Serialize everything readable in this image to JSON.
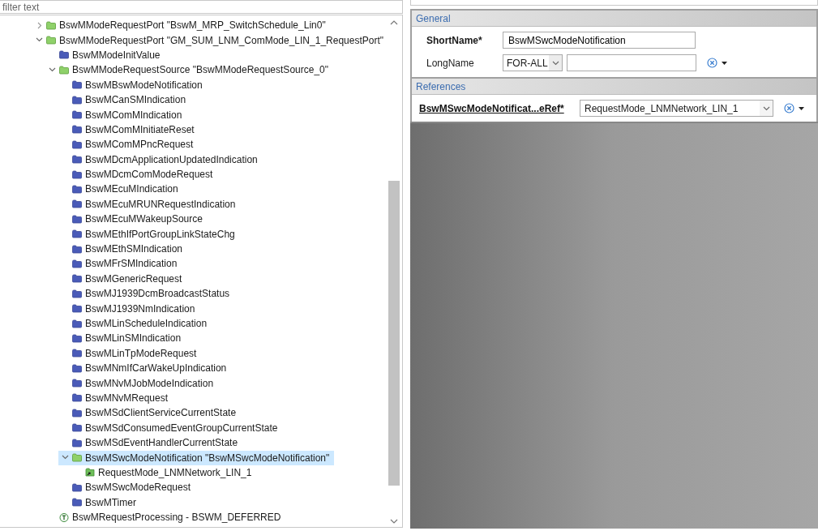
{
  "filter": {
    "placeholder": "filter text"
  },
  "tree": [
    {
      "kind": "container",
      "label": "BswMModeRequestPort \"BswM_MRP_SwitchSchedule_Lin0\"",
      "expanded": false,
      "selected": false
    },
    {
      "kind": "container",
      "label": "BswMModeRequestPort \"GM_SUM_LNM_ComMode_LIN_1_RequestPort\"",
      "expanded": true,
      "selected": false,
      "children": [
        {
          "kind": "folder",
          "label": "BswMModeInitValue",
          "selected": false
        },
        {
          "kind": "container",
          "label": "BswMModeRequestSource \"BswMModeRequestSource_0\"",
          "expanded": true,
          "selected": false,
          "children": [
            {
              "kind": "folder",
              "label": "BswMBswModeNotification",
              "selected": false
            },
            {
              "kind": "folder",
              "label": "BswMCanSMIndication",
              "selected": false
            },
            {
              "kind": "folder",
              "label": "BswMComMIndication",
              "selected": false
            },
            {
              "kind": "folder",
              "label": "BswMComMInitiateReset",
              "selected": false
            },
            {
              "kind": "folder",
              "label": "BswMComMPncRequest",
              "selected": false
            },
            {
              "kind": "folder",
              "label": "BswMDcmApplicationUpdatedIndication",
              "selected": false
            },
            {
              "kind": "folder",
              "label": "BswMDcmComModeRequest",
              "selected": false
            },
            {
              "kind": "folder",
              "label": "BswMEcuMIndication",
              "selected": false
            },
            {
              "kind": "folder",
              "label": "BswMEcuMRUNRequestIndication",
              "selected": false
            },
            {
              "kind": "folder",
              "label": "BswMEcuMWakeupSource",
              "selected": false
            },
            {
              "kind": "folder",
              "label": "BswMEthIfPortGroupLinkStateChg",
              "selected": false
            },
            {
              "kind": "folder",
              "label": "BswMEthSMIndication",
              "selected": false
            },
            {
              "kind": "folder",
              "label": "BswMFrSMIndication",
              "selected": false
            },
            {
              "kind": "folder",
              "label": "BswMGenericRequest",
              "selected": false
            },
            {
              "kind": "folder",
              "label": "BswMJ1939DcmBroadcastStatus",
              "selected": false
            },
            {
              "kind": "folder",
              "label": "BswMJ1939NmIndication",
              "selected": false
            },
            {
              "kind": "folder",
              "label": "BswMLinScheduleIndication",
              "selected": false
            },
            {
              "kind": "folder",
              "label": "BswMLinSMIndication",
              "selected": false
            },
            {
              "kind": "folder",
              "label": "BswMLinTpModeRequest",
              "selected": false
            },
            {
              "kind": "folder",
              "label": "BswMNmIfCarWakeUpIndication",
              "selected": false
            },
            {
              "kind": "folder",
              "label": "BswMNvMJobModeIndication",
              "selected": false
            },
            {
              "kind": "folder",
              "label": "BswMNvMRequest",
              "selected": false
            },
            {
              "kind": "folder",
              "label": "BswMSdClientServiceCurrentState",
              "selected": false
            },
            {
              "kind": "folder",
              "label": "BswMSdConsumedEventGroupCurrentState",
              "selected": false
            },
            {
              "kind": "folder",
              "label": "BswMSdEventHandlerCurrentState",
              "selected": false
            },
            {
              "kind": "container",
              "label": "BswMSwcModeNotification \"BswMSwcModeNotification\"",
              "expanded": true,
              "selected": true,
              "children": [
                {
                  "kind": "reference",
                  "label": "RequestMode_LNMNetwork_LIN_1",
                  "selected": false
                }
              ]
            },
            {
              "kind": "folder",
              "label": "BswMSwcModeRequest",
              "selected": false
            },
            {
              "kind": "folder",
              "label": "BswMTimer",
              "selected": false
            }
          ]
        },
        {
          "kind": "parameter",
          "label": "BswMRequestProcessing - BSWM_DEFERRED",
          "selected": false
        }
      ]
    }
  ],
  "general": {
    "title": "General",
    "fields": [
      {
        "kind": "text",
        "label": "ShortName*",
        "required": true,
        "value": "BswMSwcModeNotification"
      },
      {
        "kind": "multilang",
        "label": "LongName",
        "required": false,
        "language": "FOR-ALL"
      }
    ]
  },
  "references": {
    "title": "References",
    "items": [
      {
        "label": "BswMSwcModeNotificat...eRef*",
        "value": "RequestMode_LNMNetwork_LIN_1"
      }
    ]
  }
}
